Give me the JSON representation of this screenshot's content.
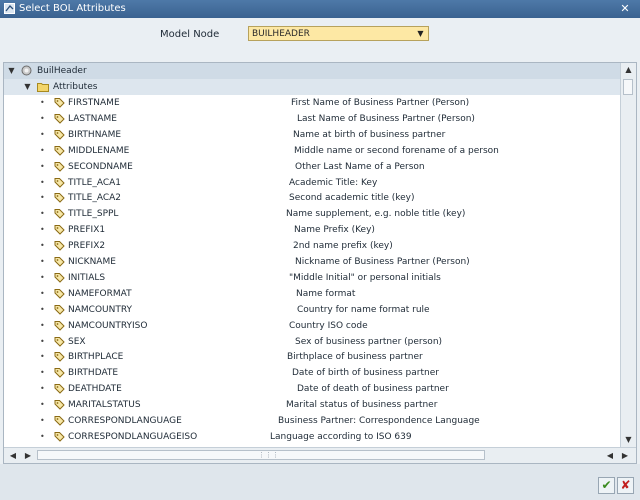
{
  "window": {
    "title": "Select BOL Attributes",
    "close_glyph": "✕"
  },
  "model": {
    "label": "Model Node",
    "value": "BUILHEADER"
  },
  "tree": {
    "root": "BuilHeader",
    "folder": "Attributes",
    "attributes": [
      {
        "name": "FIRSTNAME",
        "desc": "First Name of Business Partner (Person)"
      },
      {
        "name": "LASTNAME",
        "desc": "Last Name of Business Partner (Person)"
      },
      {
        "name": "BIRTHNAME",
        "desc": "Name at birth of business partner"
      },
      {
        "name": "MIDDLENAME",
        "desc": "Middle name or second forename of a person"
      },
      {
        "name": "SECONDNAME",
        "desc": "Other Last Name of a Person"
      },
      {
        "name": "TITLE_ACA1",
        "desc": "Academic Title: Key"
      },
      {
        "name": "TITLE_ACA2",
        "desc": "Second academic title (key)"
      },
      {
        "name": "TITLE_SPPL",
        "desc": "Name supplement, e.g. noble title (key)"
      },
      {
        "name": "PREFIX1",
        "desc": "Name Prefix (Key)"
      },
      {
        "name": "PREFIX2",
        "desc": "2nd name prefix (key)"
      },
      {
        "name": "NICKNAME",
        "desc": "Nickname of Business Partner (Person)"
      },
      {
        "name": "INITIALS",
        "desc": "\"Middle Initial\" or personal initials"
      },
      {
        "name": "NAMEFORMAT",
        "desc": "Name format"
      },
      {
        "name": "NAMCOUNTRY",
        "desc": "Country for name format rule"
      },
      {
        "name": "NAMCOUNTRYISO",
        "desc": "Country ISO code"
      },
      {
        "name": "SEX",
        "desc": "Sex of business partner (person)"
      },
      {
        "name": "BIRTHPLACE",
        "desc": "Birthplace of business partner"
      },
      {
        "name": "BIRTHDATE",
        "desc": "Date of birth of business partner"
      },
      {
        "name": "DEATHDATE",
        "desc": "Date of death of business partner"
      },
      {
        "name": "MARITALSTATUS",
        "desc": "Marital status of business partner"
      },
      {
        "name": "CORRESPONDLANGUAGE",
        "desc": "Business Partner: Correspondence Language"
      },
      {
        "name": "CORRESPONDLANGUAGEISO",
        "desc": "Language according to ISO 639"
      }
    ]
  },
  "footer": {
    "ok_glyph": "✔",
    "cancel_glyph": "✘"
  },
  "colors": {
    "titlebar": "#3f6b9b",
    "selected_field": "#fde8a4",
    "ok": "#3a8b1f",
    "cancel": "#c21f1f"
  }
}
